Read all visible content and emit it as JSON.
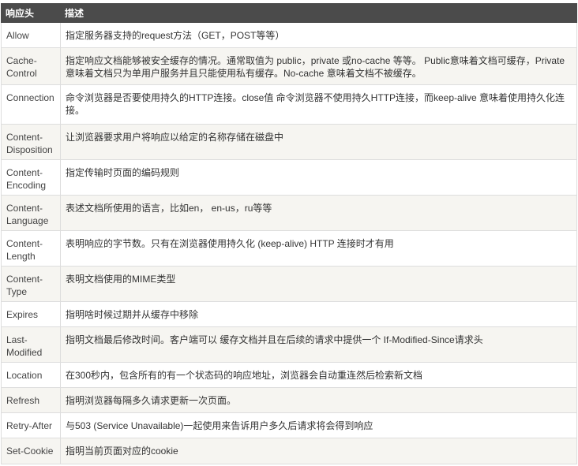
{
  "headers": [
    "响应头",
    "描述"
  ],
  "rows": [
    {
      "name": "Allow",
      "desc": "指定服务器支持的request方法（GET，POST等等）"
    },
    {
      "name": "Cache-Control",
      "desc": "指定响应文档能够被安全缓存的情况。通常取值为 public，private 或no-cache 等等。 Public意味着文档可缓存，Private意味着文档只为单用户服务并且只能使用私有缓存。No-cache 意味着文档不被缓存。"
    },
    {
      "name": "Connection",
      "desc": "命令浏览器是否要使用持久的HTTP连接。close值 命令浏览器不使用持久HTTP连接，而keep-alive 意味着使用持久化连接。"
    },
    {
      "name": "Content-Disposition",
      "desc": "让浏览器要求用户将响应以给定的名称存储在磁盘中"
    },
    {
      "name": "Content-Encoding",
      "desc": "指定传输时页面的编码规则"
    },
    {
      "name": "Content-Language",
      "desc": "表述文档所使用的语言，比如en， en-us，ru等等"
    },
    {
      "name": "Content-Length",
      "desc": "表明响应的字节数。只有在浏览器使用持久化 (keep-alive) HTTP 连接时才有用"
    },
    {
      "name": "Content-Type",
      "desc": "表明文档使用的MIME类型"
    },
    {
      "name": "Expires",
      "desc": "指明啥时候过期并从缓存中移除"
    },
    {
      "name": "Last-Modified",
      "desc": "指明文档最后修改时间。客户端可以 缓存文档并且在后续的请求中提供一个 If-Modified-Since请求头"
    },
    {
      "name": "Location",
      "desc": "在300秒内，包含所有的有一个状态码的响应地址，浏览器会自动重连然后检索新文档"
    },
    {
      "name": "Refresh",
      "desc": "指明浏览器每隔多久请求更新一次页面。"
    },
    {
      "name": "Retry-After",
      "desc": "与503 (Service Unavailable)一起使用来告诉用户多久后请求将会得到响应"
    },
    {
      "name": "Set-Cookie",
      "desc": "指明当前页面对应的cookie"
    }
  ]
}
